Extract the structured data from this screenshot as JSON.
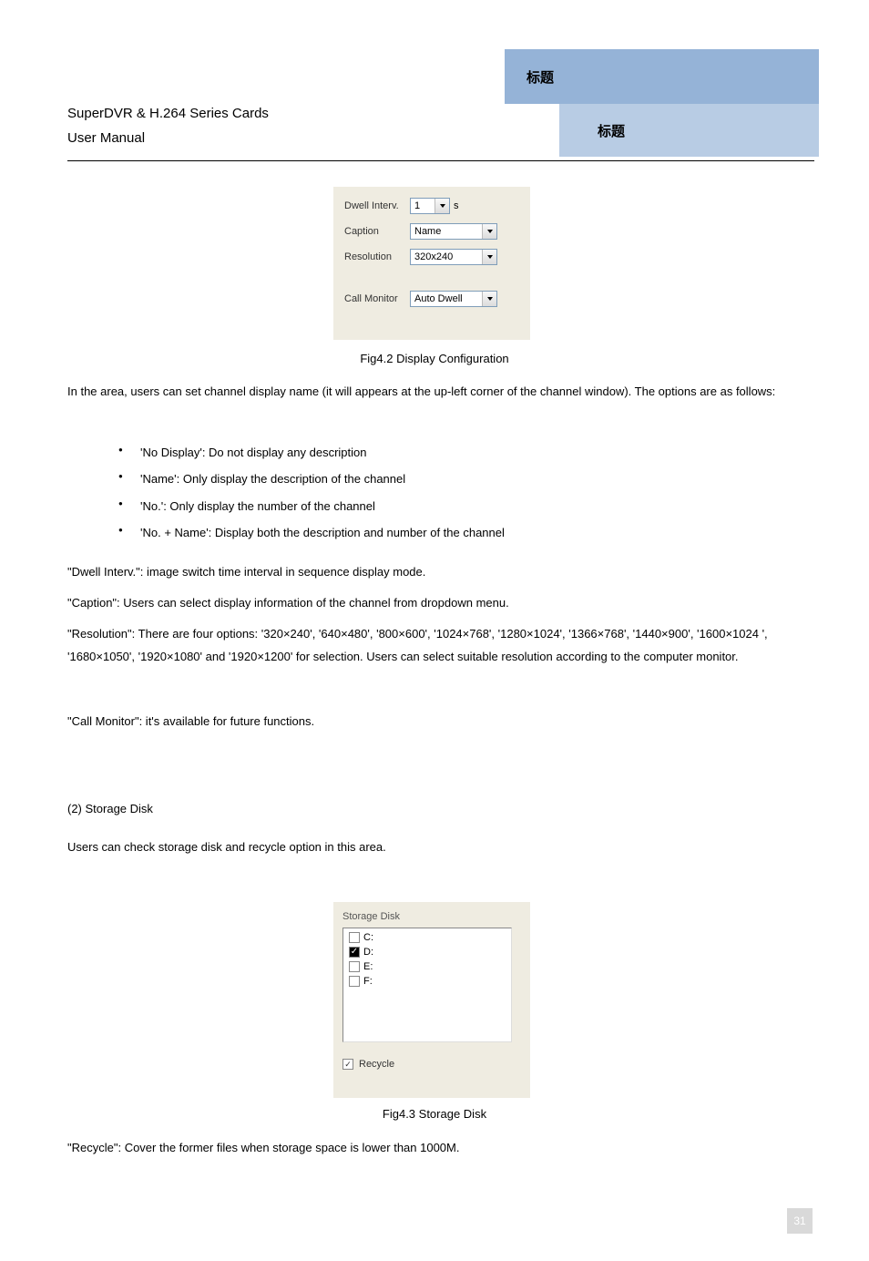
{
  "tabs": {
    "large": "标题",
    "small": "标题"
  },
  "header": {
    "line1": "SuperDVR & H.264 Series Cards",
    "line2": "User Manual"
  },
  "panel_display": {
    "dwell_label": "Dwell Interv.",
    "dwell_value": "1",
    "dwell_unit": "s",
    "caption_label": "Caption",
    "caption_value": "Name",
    "resolution_label": "Resolution",
    "resolution_value": "320x240",
    "callmon_label": "Call Monitor",
    "callmon_value": "Auto Dwell"
  },
  "fig1_caption": "Fig4.2 Display Configuration",
  "para_display_intro": "In the area, users can set channel display name (it will appears at the up-left corner of the  channel window). The options are as follows:",
  "bullets": [
    "'No Display': Do not display any description",
    "'Name': Only display the description of the channel",
    "'No.': Only display the number of the channel",
    "'No. + Name': Display both the description and number of the channel"
  ],
  "para_dwell": "\"Dwell Interv.\": image switch time interval in sequence display mode.",
  "para_caption": "\"Caption\": Users can select display information of the channel from dropdown menu.",
  "para_res": "\"Resolution\": There are four options: '320×240', '640×480', '800×600', '1024×768', '1280×1024', '1366×768', '1440×900', '1600×1024 ', '1680×1050', '1920×1080' and '1920×1200' for selection. Users can select suitable resolution according to the computer monitor.",
  "para_callmon": "\"Call Monitor\": it's available for future functions.",
  "section_head": "(2) Storage Disk",
  "para_storage_intro": "Users can check storage disk and recycle option in this area.",
  "panel_storage": {
    "title": "Storage Disk",
    "disks": [
      {
        "label": "C:",
        "checked": false
      },
      {
        "label": "D:",
        "checked": true
      },
      {
        "label": "E:",
        "checked": false
      },
      {
        "label": "F:",
        "checked": false
      }
    ],
    "recycle_label": "Recycle",
    "recycle_checked": true
  },
  "fig2_caption": "Fig4.3 Storage Disk",
  "para_recycle": "\"Recycle\": Cover the former files when storage space is lower than 1000M.",
  "page_number": "31"
}
